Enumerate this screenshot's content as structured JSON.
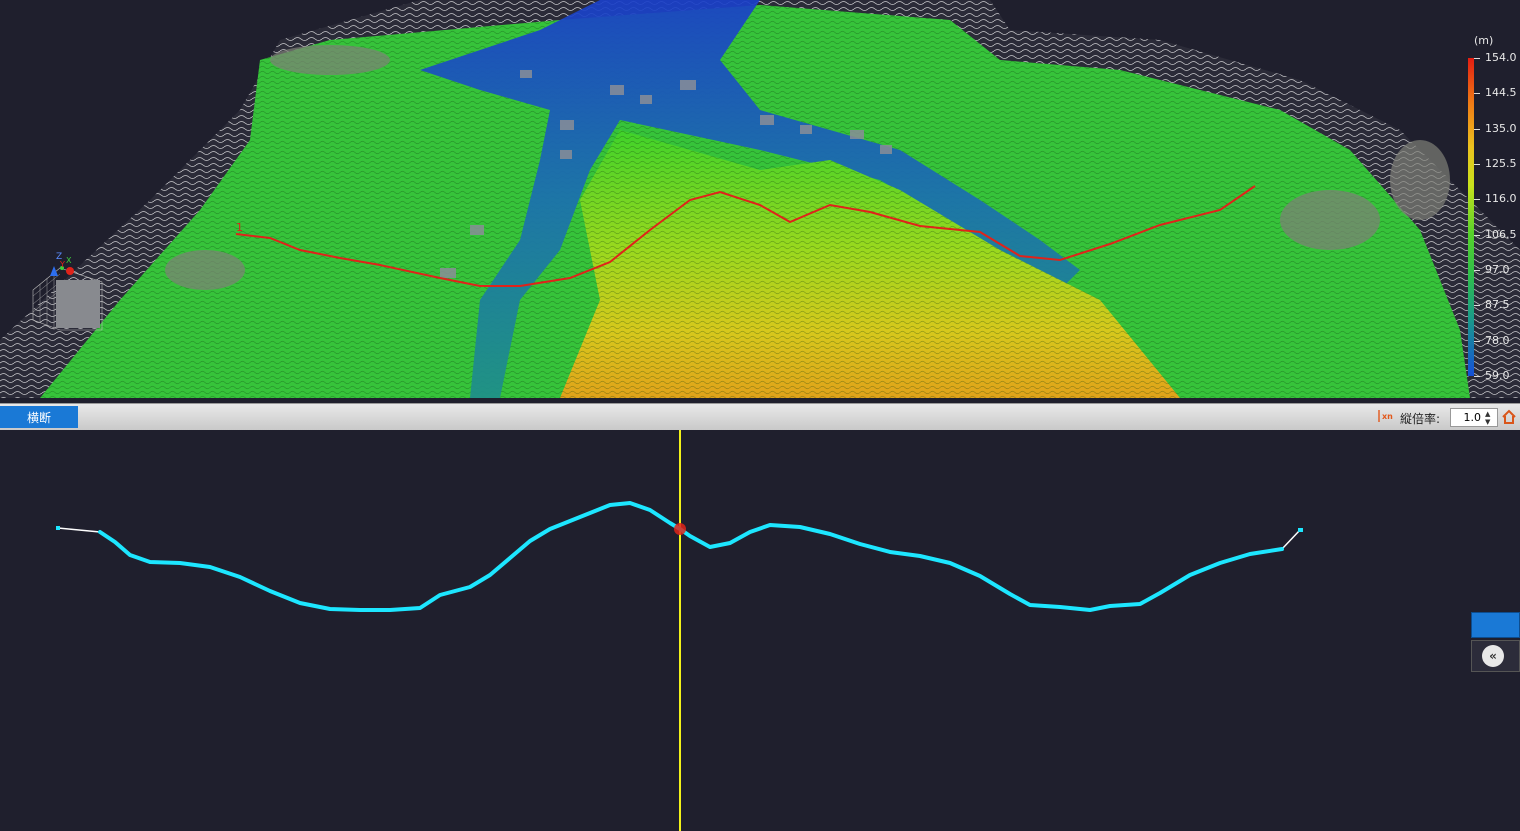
{
  "toolbar": {
    "tab_label": "横断",
    "vertical_exaggeration_label": "縦倍率:",
    "vertical_exaggeration_value": "1.0",
    "spin_up": "▲",
    "spin_down": "▼",
    "xn_icon_text": "xn"
  },
  "legend": {
    "unit": "(m)",
    "values": [
      "154.0",
      "144.5",
      "135.0",
      "125.5",
      "116.0",
      "106.5",
      "97.0",
      "87.5",
      "78.0",
      "59.0"
    ]
  },
  "viewport": {
    "axis_labels": [
      "Z",
      "Y",
      "X"
    ],
    "marker_label": "1"
  },
  "side_panel": {
    "collapse_glyph": "«"
  },
  "colors": {
    "background": "#1f1f2d",
    "profile_line": "#1de6ff",
    "cursor_line": "#f2f21a",
    "route_line": "#e0231a",
    "accent": "#1a79d6"
  },
  "icons": [
    "axis-gizmo-icon",
    "xn-icon",
    "home-icon",
    "double-chevron-left-icon"
  ]
}
